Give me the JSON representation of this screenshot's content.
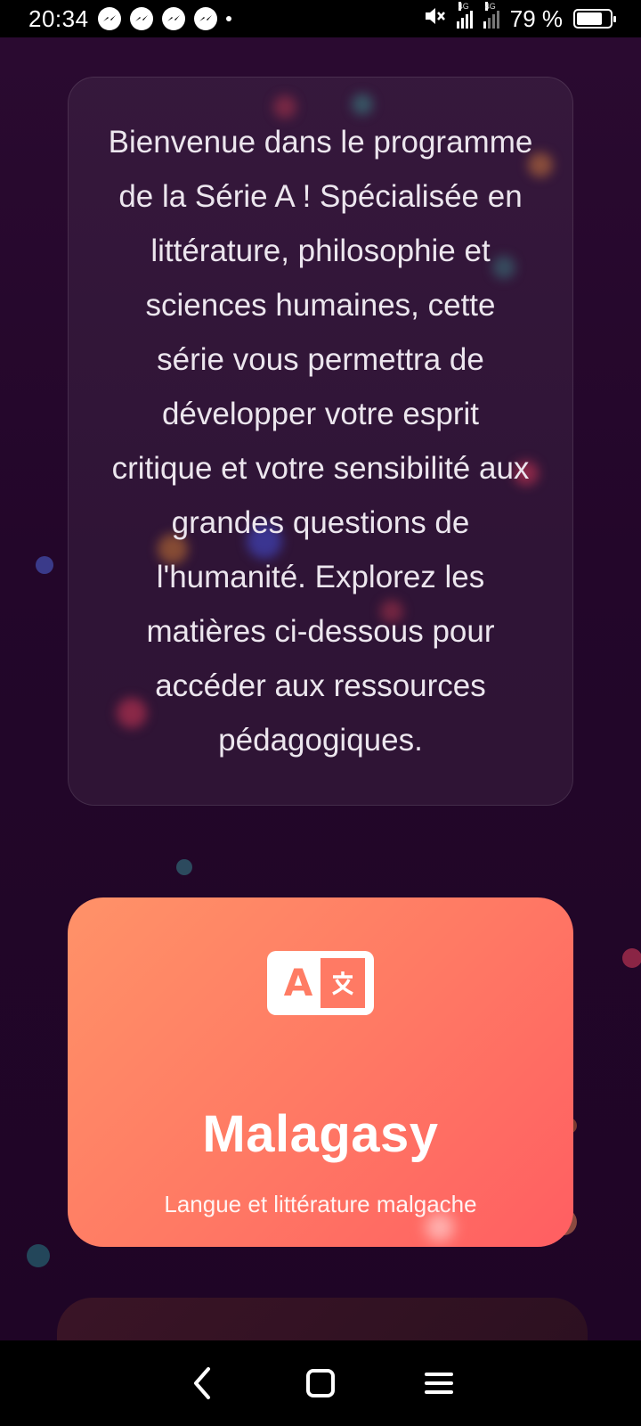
{
  "status_bar": {
    "time": "20:34",
    "notification_icons": [
      "messenger-icon",
      "messenger-icon",
      "messenger-icon",
      "messenger-icon"
    ],
    "network_1": "4G",
    "network_2": "4G",
    "battery_percent": "79 %",
    "battery_level": 0.79
  },
  "intro": {
    "text": "Bienvenue dans le programme de la Série A ! Spécialisée en littérature, philosophie et sciences humaines, cette série vous permettra de développer votre esprit critique et votre sensibilité aux grandes questions de l'humanité. Explorez les matières ci-dessous pour accéder aux ressources pédagogiques."
  },
  "subjects": [
    {
      "icon": "translate-icon",
      "title": "Malagasy",
      "description": "Langue et littérature malgache",
      "gradient": [
        "#ff9268",
        "#ff5e62"
      ]
    }
  ],
  "nav": {
    "icons": [
      "back-icon",
      "home-icon",
      "menu-icon"
    ]
  },
  "colors": {
    "background": "#23062a",
    "card_text": "#ece6ee",
    "accent": "#ff7a64"
  }
}
